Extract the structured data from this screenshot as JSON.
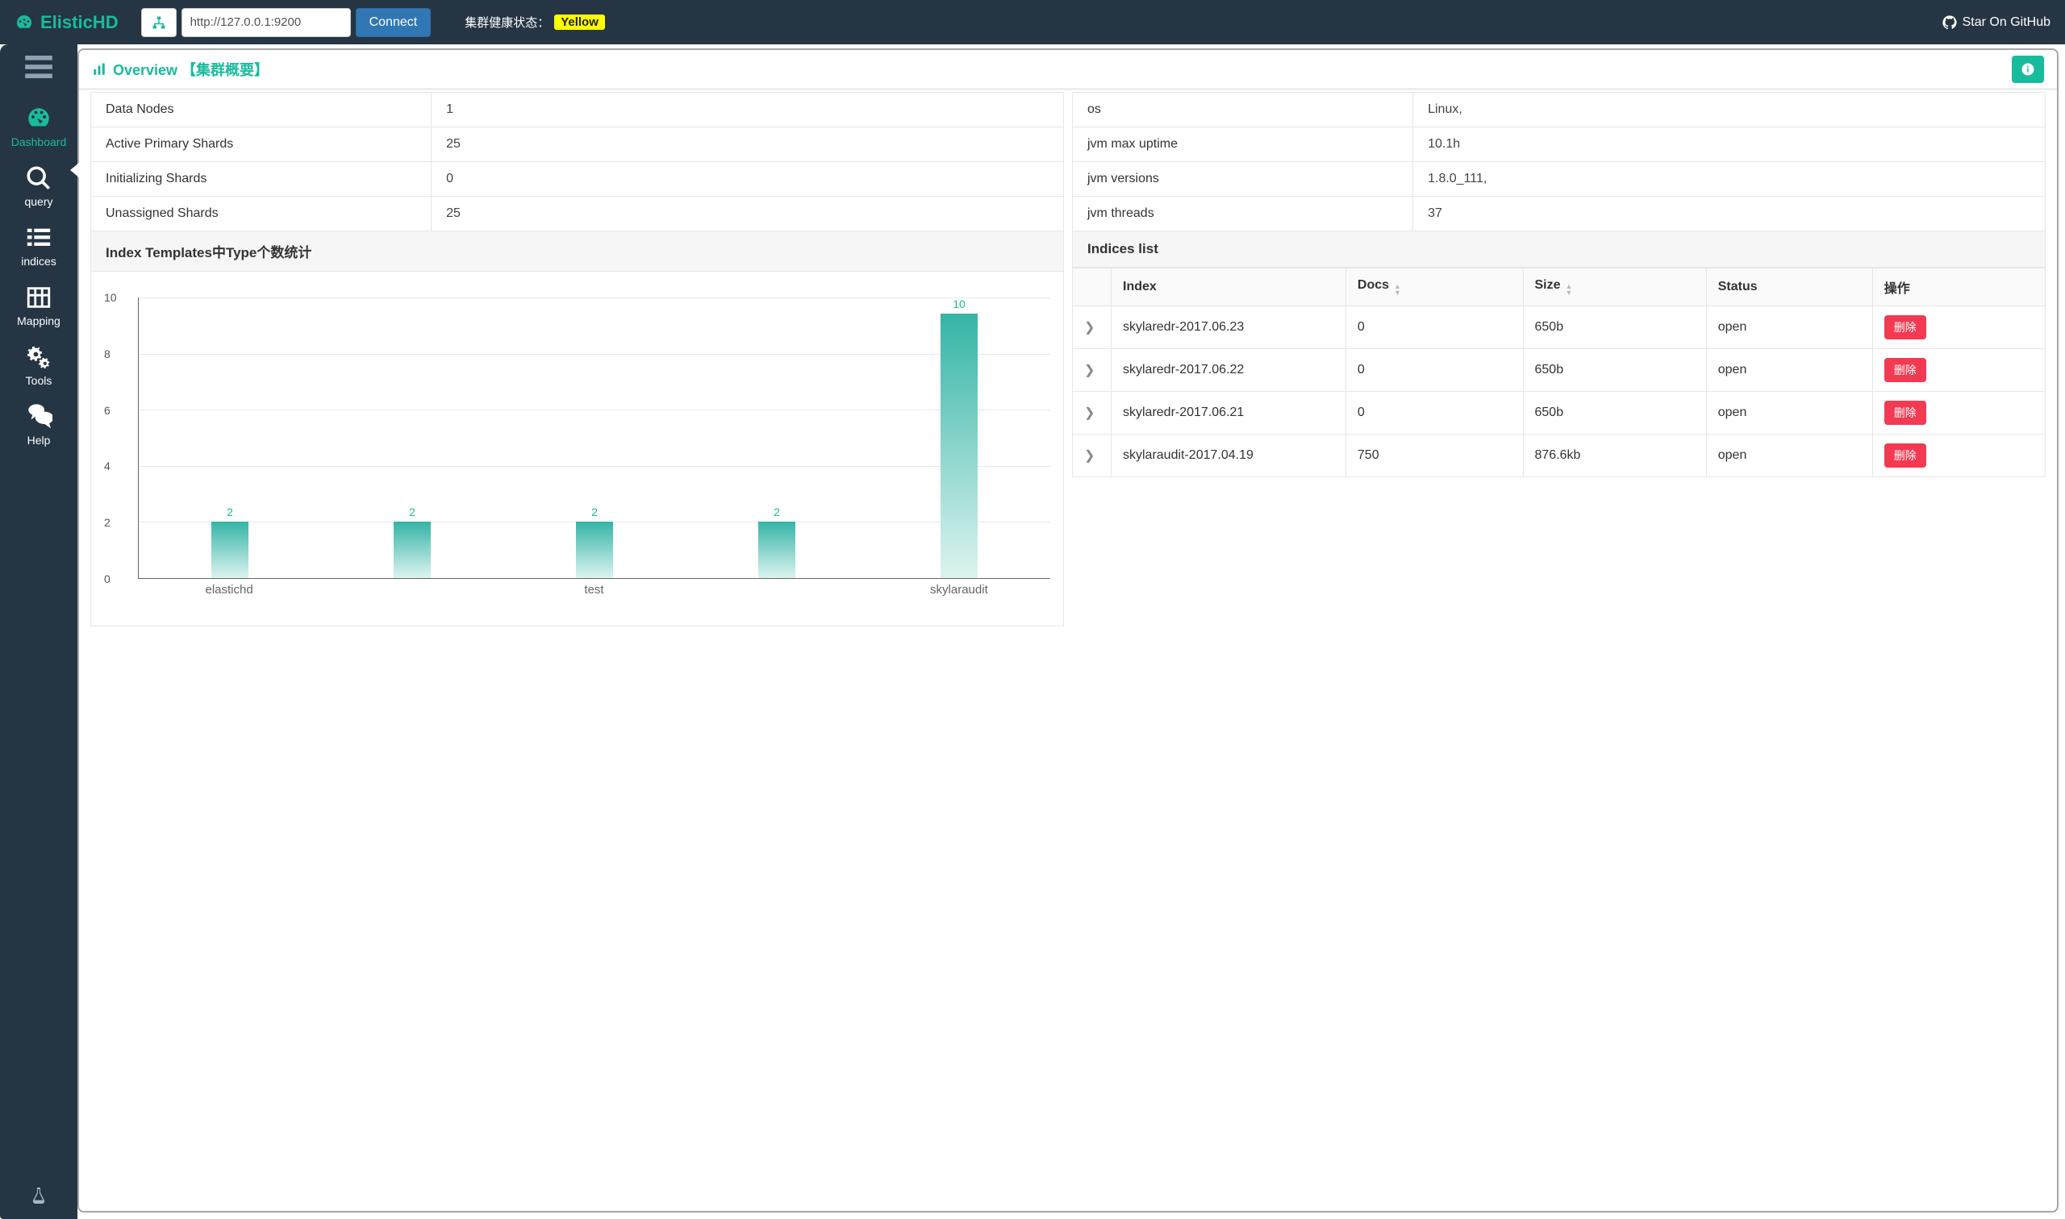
{
  "brand": "ElisticHD",
  "connect": {
    "url": "http://127.0.0.1:9200",
    "button": "Connect"
  },
  "health": {
    "label": "集群健康状态：",
    "value": "Yellow",
    "color_bg": "yellow"
  },
  "github": {
    "label": "Star On GitHub"
  },
  "sidebar": {
    "items": [
      {
        "id": "dashboard",
        "label": "Dashboard",
        "active": true
      },
      {
        "id": "query",
        "label": "query"
      },
      {
        "id": "indices",
        "label": "indices"
      },
      {
        "id": "mapping",
        "label": "Mapping"
      },
      {
        "id": "tools",
        "label": "Tools"
      },
      {
        "id": "help",
        "label": "Help"
      }
    ]
  },
  "panel": {
    "title": "Overview 【集群概要】",
    "info_tooltip": "info"
  },
  "stats_left": [
    {
      "k": "Data Nodes",
      "v": "1"
    },
    {
      "k": "Active Primary Shards",
      "v": "25"
    },
    {
      "k": "Initializing Shards",
      "v": "0"
    },
    {
      "k": "Unassigned Shards",
      "v": "25"
    }
  ],
  "stats_right": [
    {
      "k": "os",
      "v": "Linux,"
    },
    {
      "k": "jvm max uptime",
      "v": "10.1h"
    },
    {
      "k": "jvm versions",
      "v": "1.8.0_111,"
    },
    {
      "k": "jvm threads",
      "v": "37"
    }
  ],
  "sections": {
    "templates_title": "Index Templates中Type个数统计",
    "indices_title": "Indices list"
  },
  "chart_data": {
    "type": "bar",
    "categories": [
      "elastichd",
      "",
      "test",
      "",
      "skylaraudit"
    ],
    "values": [
      2,
      2,
      2,
      2,
      10
    ],
    "x_labels_visible": [
      "elastichd",
      "test",
      "skylaraudit"
    ],
    "title": "",
    "xlabel": "",
    "ylabel": "",
    "ylim": [
      0,
      10
    ],
    "yticks": [
      0,
      2,
      4,
      6,
      8,
      10
    ]
  },
  "indices_table": {
    "columns": {
      "index": "Index",
      "docs": "Docs",
      "size": "Size",
      "status": "Status",
      "ops": "操作"
    },
    "delete_label": "删除",
    "rows": [
      {
        "index": "skylaredr-2017.06.23",
        "docs": "0",
        "size": "650b",
        "status": "open"
      },
      {
        "index": "skylaredr-2017.06.22",
        "docs": "0",
        "size": "650b",
        "status": "open"
      },
      {
        "index": "skylaredr-2017.06.21",
        "docs": "0",
        "size": "650b",
        "status": "open"
      },
      {
        "index": "skylaraudit-2017.04.19",
        "docs": "750",
        "size": "876.6kb",
        "status": "open"
      }
    ]
  }
}
